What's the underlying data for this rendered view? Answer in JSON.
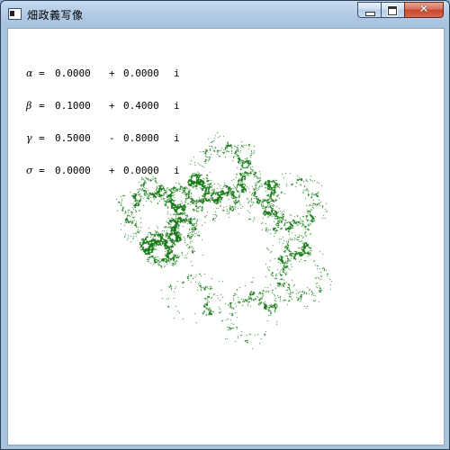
{
  "window": {
    "title": "畑政義写像",
    "buttons": {
      "minimize_icon": "minimize-icon",
      "maximize_icon": "maximize-icon",
      "close_icon": "close-icon"
    }
  },
  "parameters": [
    {
      "symbol": "α",
      "eq": "=",
      "re": "0.0000",
      "op": "+",
      "im": "0.0000",
      "unit": "i"
    },
    {
      "symbol": "β",
      "eq": "=",
      "re": "0.1000",
      "op": "+",
      "im": "0.4000",
      "unit": "i"
    },
    {
      "symbol": "γ",
      "eq": "=",
      "re": "0.5000",
      "op": "-",
      "im": "0.8000",
      "unit": "i"
    },
    {
      "symbol": "σ",
      "eq": "=",
      "re": "0.0000",
      "op": "+",
      "im": "0.0000",
      "unit": "i"
    }
  ],
  "colors": {
    "fractal": "#1a7a1a",
    "background": "#ffffff"
  }
}
